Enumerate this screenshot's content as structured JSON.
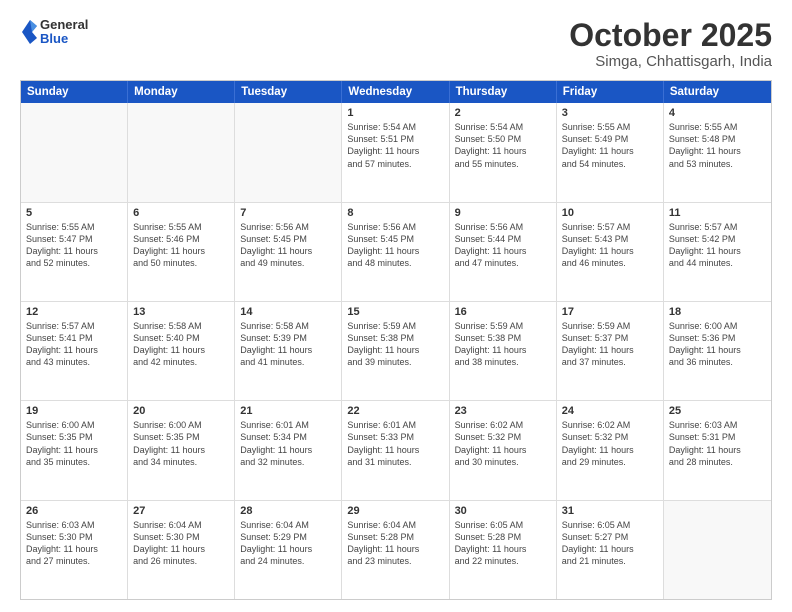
{
  "header": {
    "logo_line1": "General",
    "logo_line2": "Blue",
    "month": "October 2025",
    "location": "Simga, Chhattisgarh, India"
  },
  "days_of_week": [
    "Sunday",
    "Monday",
    "Tuesday",
    "Wednesday",
    "Thursday",
    "Friday",
    "Saturday"
  ],
  "weeks": [
    [
      {
        "day": "",
        "text": ""
      },
      {
        "day": "",
        "text": ""
      },
      {
        "day": "",
        "text": ""
      },
      {
        "day": "1",
        "text": "Sunrise: 5:54 AM\nSunset: 5:51 PM\nDaylight: 11 hours\nand 57 minutes."
      },
      {
        "day": "2",
        "text": "Sunrise: 5:54 AM\nSunset: 5:50 PM\nDaylight: 11 hours\nand 55 minutes."
      },
      {
        "day": "3",
        "text": "Sunrise: 5:55 AM\nSunset: 5:49 PM\nDaylight: 11 hours\nand 54 minutes."
      },
      {
        "day": "4",
        "text": "Sunrise: 5:55 AM\nSunset: 5:48 PM\nDaylight: 11 hours\nand 53 minutes."
      }
    ],
    [
      {
        "day": "5",
        "text": "Sunrise: 5:55 AM\nSunset: 5:47 PM\nDaylight: 11 hours\nand 52 minutes."
      },
      {
        "day": "6",
        "text": "Sunrise: 5:55 AM\nSunset: 5:46 PM\nDaylight: 11 hours\nand 50 minutes."
      },
      {
        "day": "7",
        "text": "Sunrise: 5:56 AM\nSunset: 5:45 PM\nDaylight: 11 hours\nand 49 minutes."
      },
      {
        "day": "8",
        "text": "Sunrise: 5:56 AM\nSunset: 5:45 PM\nDaylight: 11 hours\nand 48 minutes."
      },
      {
        "day": "9",
        "text": "Sunrise: 5:56 AM\nSunset: 5:44 PM\nDaylight: 11 hours\nand 47 minutes."
      },
      {
        "day": "10",
        "text": "Sunrise: 5:57 AM\nSunset: 5:43 PM\nDaylight: 11 hours\nand 46 minutes."
      },
      {
        "day": "11",
        "text": "Sunrise: 5:57 AM\nSunset: 5:42 PM\nDaylight: 11 hours\nand 44 minutes."
      }
    ],
    [
      {
        "day": "12",
        "text": "Sunrise: 5:57 AM\nSunset: 5:41 PM\nDaylight: 11 hours\nand 43 minutes."
      },
      {
        "day": "13",
        "text": "Sunrise: 5:58 AM\nSunset: 5:40 PM\nDaylight: 11 hours\nand 42 minutes."
      },
      {
        "day": "14",
        "text": "Sunrise: 5:58 AM\nSunset: 5:39 PM\nDaylight: 11 hours\nand 41 minutes."
      },
      {
        "day": "15",
        "text": "Sunrise: 5:59 AM\nSunset: 5:38 PM\nDaylight: 11 hours\nand 39 minutes."
      },
      {
        "day": "16",
        "text": "Sunrise: 5:59 AM\nSunset: 5:38 PM\nDaylight: 11 hours\nand 38 minutes."
      },
      {
        "day": "17",
        "text": "Sunrise: 5:59 AM\nSunset: 5:37 PM\nDaylight: 11 hours\nand 37 minutes."
      },
      {
        "day": "18",
        "text": "Sunrise: 6:00 AM\nSunset: 5:36 PM\nDaylight: 11 hours\nand 36 minutes."
      }
    ],
    [
      {
        "day": "19",
        "text": "Sunrise: 6:00 AM\nSunset: 5:35 PM\nDaylight: 11 hours\nand 35 minutes."
      },
      {
        "day": "20",
        "text": "Sunrise: 6:00 AM\nSunset: 5:35 PM\nDaylight: 11 hours\nand 34 minutes."
      },
      {
        "day": "21",
        "text": "Sunrise: 6:01 AM\nSunset: 5:34 PM\nDaylight: 11 hours\nand 32 minutes."
      },
      {
        "day": "22",
        "text": "Sunrise: 6:01 AM\nSunset: 5:33 PM\nDaylight: 11 hours\nand 31 minutes."
      },
      {
        "day": "23",
        "text": "Sunrise: 6:02 AM\nSunset: 5:32 PM\nDaylight: 11 hours\nand 30 minutes."
      },
      {
        "day": "24",
        "text": "Sunrise: 6:02 AM\nSunset: 5:32 PM\nDaylight: 11 hours\nand 29 minutes."
      },
      {
        "day": "25",
        "text": "Sunrise: 6:03 AM\nSunset: 5:31 PM\nDaylight: 11 hours\nand 28 minutes."
      }
    ],
    [
      {
        "day": "26",
        "text": "Sunrise: 6:03 AM\nSunset: 5:30 PM\nDaylight: 11 hours\nand 27 minutes."
      },
      {
        "day": "27",
        "text": "Sunrise: 6:04 AM\nSunset: 5:30 PM\nDaylight: 11 hours\nand 26 minutes."
      },
      {
        "day": "28",
        "text": "Sunrise: 6:04 AM\nSunset: 5:29 PM\nDaylight: 11 hours\nand 24 minutes."
      },
      {
        "day": "29",
        "text": "Sunrise: 6:04 AM\nSunset: 5:28 PM\nDaylight: 11 hours\nand 23 minutes."
      },
      {
        "day": "30",
        "text": "Sunrise: 6:05 AM\nSunset: 5:28 PM\nDaylight: 11 hours\nand 22 minutes."
      },
      {
        "day": "31",
        "text": "Sunrise: 6:05 AM\nSunset: 5:27 PM\nDaylight: 11 hours\nand 21 minutes."
      },
      {
        "day": "",
        "text": ""
      }
    ]
  ]
}
